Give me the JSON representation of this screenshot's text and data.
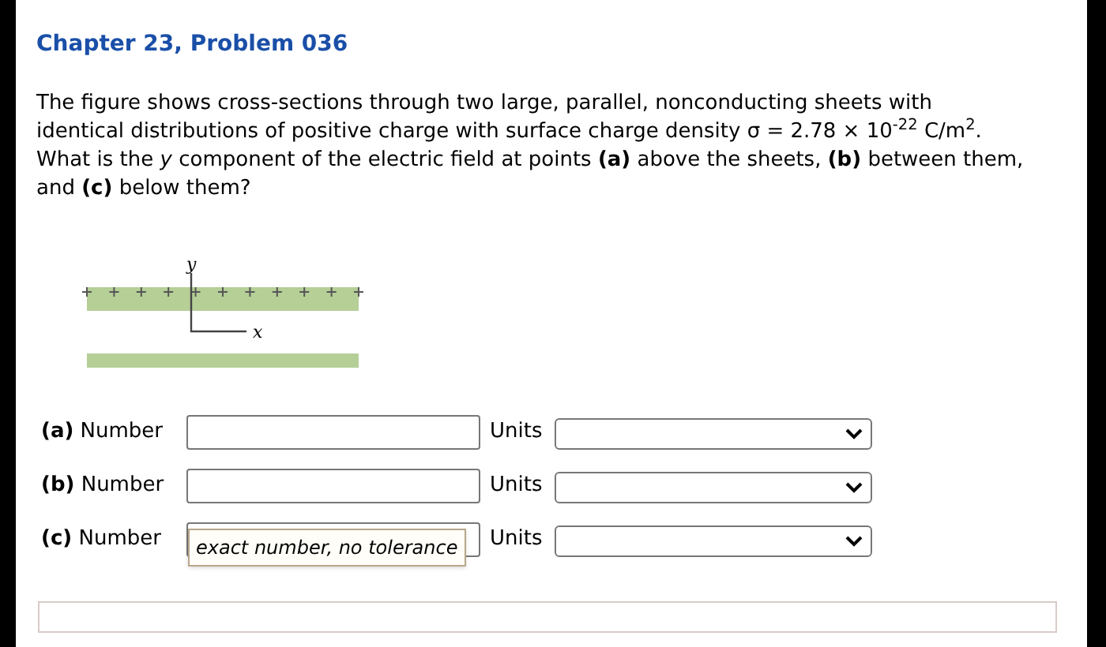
{
  "title": "Chapter 23, Problem 036",
  "question": "The figure shows cross-sections through two large, parallel, nonconducting sheets with identical distributions of positive charge with surface charge density σ = 2.78 × 10$^{-22}$ C/m$^{2}$. What is the *y* component of the electric field at points **(a)** above the sheets, **(b)** between them, and **(c)** below them?",
  "figure": {
    "y_axis_label": "y",
    "x_axis_label": "x"
  },
  "answers": [
    {
      "part": "(a)",
      "label": "Number",
      "units_label": "Units"
    },
    {
      "part": "(b)",
      "label": "Number",
      "units_label": "Units"
    },
    {
      "part": "(c)",
      "label": "Number",
      "units_label": "Units",
      "tooltip": "exact number, no tolerance"
    }
  ]
}
